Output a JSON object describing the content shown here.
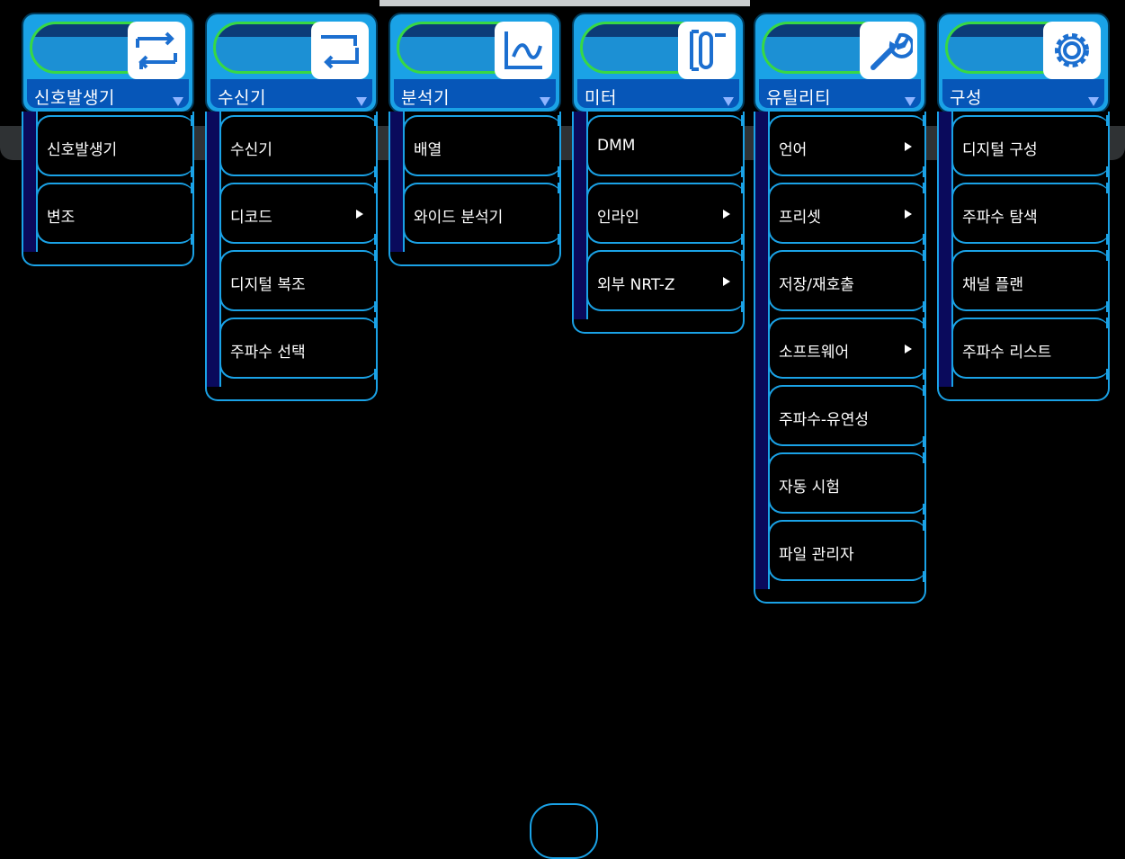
{
  "menus": [
    {
      "title": "신호발생기",
      "icon": "swap-arrows-icon",
      "items": [
        {
          "label": "신호발생기",
          "submenu": false
        },
        {
          "label": "변조",
          "submenu": false
        }
      ]
    },
    {
      "title": "수신기",
      "icon": "receive-arrows-icon",
      "items": [
        {
          "label": "수신기",
          "submenu": false
        },
        {
          "label": "디코드",
          "submenu": true
        },
        {
          "label": "디지털 복조",
          "submenu": false
        },
        {
          "label": "주파수 선택",
          "submenu": false
        }
      ]
    },
    {
      "title": "분석기",
      "icon": "waveform-icon",
      "items": [
        {
          "label": "배열",
          "submenu": false
        },
        {
          "label": "와이드 분석기",
          "submenu": false
        }
      ]
    },
    {
      "title": "미터",
      "icon": "meter-icon",
      "items": [
        {
          "label": "DMM",
          "submenu": false
        },
        {
          "label": "인라인",
          "submenu": true
        },
        {
          "label": "외부 NRT-Z",
          "submenu": true
        }
      ]
    },
    {
      "title": "유틸리티",
      "icon": "wrench-icon",
      "items": [
        {
          "label": "언어",
          "submenu": true
        },
        {
          "label": "프리셋",
          "submenu": true
        },
        {
          "label": "저장/재호출",
          "submenu": false
        },
        {
          "label": "소프트웨어",
          "submenu": true
        },
        {
          "label": "주파수-유연성",
          "submenu": false
        },
        {
          "label": "자동 시험",
          "submenu": false
        },
        {
          "label": "파일 관리자",
          "submenu": false
        }
      ]
    },
    {
      "title": "구성",
      "icon": "gear-icon",
      "items": [
        {
          "label": "디지털 구성",
          "submenu": false
        },
        {
          "label": "주파수 탐색",
          "submenu": false
        },
        {
          "label": "채널 플랜",
          "submenu": false
        },
        {
          "label": "주파수 리스트",
          "submenu": false
        }
      ]
    }
  ],
  "colors": {
    "accent": "#1aa2e6",
    "header_band": "#0656b8",
    "pill_border": "#38d844",
    "sidebar": "#0a0a5c"
  }
}
